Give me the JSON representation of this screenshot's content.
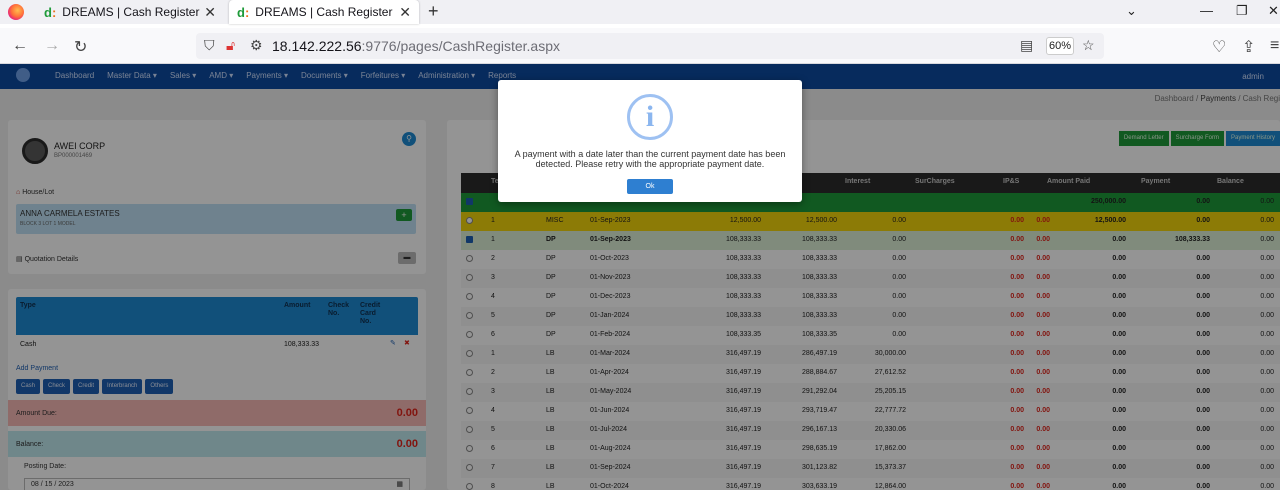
{
  "browser": {
    "tabs": [
      {
        "title": "DREAMS | Cash Register"
      },
      {
        "title": "DREAMS | Cash Register"
      }
    ],
    "url_host": "18.142.222.56",
    "url_rest": ":9776/pages/CashRegister.aspx",
    "zoom": "60%"
  },
  "app": {
    "menu": [
      "Dashboard",
      "Master Data ▾",
      "Sales ▾",
      "AMD ▾",
      "Payments ▾",
      "Documents ▾",
      "Forfeitures ▾",
      "Administration ▾",
      "Reports"
    ],
    "user": "admin",
    "breadcrumb": {
      "a": "Dashboard",
      "b": "Payments",
      "c": "Cash Regi"
    },
    "client": {
      "name": "AWEI CORP",
      "id": "BP000001469"
    },
    "house_lot_label": "House/Lot",
    "estate": {
      "title": "ANNA CARMELA ESTATES",
      "subtitle": "BLOCK 3 LOT 1 MODEL"
    },
    "quotation_label": "Quotation Details",
    "payment_table": {
      "headers": {
        "type": "Type",
        "amount": "Amount",
        "check": "Check No.",
        "credit": "Credit Card No."
      },
      "row": {
        "type": "Cash",
        "amount": "108,333.33"
      }
    },
    "add_payment_label": "Add Payment",
    "payment_buttons": [
      "Cash",
      "Check",
      "Credit",
      "Interbranch",
      "Others"
    ],
    "amount_due": {
      "label": "Amount Due:",
      "value": "0.00"
    },
    "balance": {
      "label": "Balance:",
      "value": "0.00"
    },
    "posting_date": {
      "label": "Posting Date:",
      "value": "08 / 15 / 2023"
    },
    "right_buttons": [
      "Demand Letter",
      "Surcharge Form",
      "Payment History"
    ],
    "schedule": {
      "headers": {
        "no": "Te",
        "interest": "Interest",
        "surcharges": "SurCharges",
        "ips": "IP&S",
        "amount_paid": "Amount Paid",
        "payment": "Payment",
        "balance": "Balance"
      },
      "total": {
        "amount_paid": "250,000.00",
        "payment": "0.00",
        "balance": "0.00"
      },
      "rows": [
        {
          "no": "1",
          "type": "MISC",
          "date": "01-Sep-2023",
          "amount": "12,500.00",
          "principal": "12,500.00",
          "interest": "0.00",
          "ipa": "0.00",
          "ips": "0.00",
          "paid": "12,500.00",
          "payment": "0.00",
          "balance": "0.00"
        },
        {
          "no": "1",
          "type": "DP",
          "date": "01-Sep-2023",
          "amount": "108,333.33",
          "principal": "108,333.33",
          "interest": "0.00",
          "ipa": "0.00",
          "ips": "0.00",
          "paid": "0.00",
          "payment": "108,333.33",
          "balance": "0.00"
        },
        {
          "no": "2",
          "type": "DP",
          "date": "01-Oct-2023",
          "amount": "108,333.33",
          "principal": "108,333.33",
          "interest": "0.00",
          "ipa": "0.00",
          "ips": "0.00",
          "paid": "0.00",
          "payment": "0.00",
          "balance": "0.00"
        },
        {
          "no": "3",
          "type": "DP",
          "date": "01-Nov-2023",
          "amount": "108,333.33",
          "principal": "108,333.33",
          "interest": "0.00",
          "ipa": "0.00",
          "ips": "0.00",
          "paid": "0.00",
          "payment": "0.00",
          "balance": "0.00"
        },
        {
          "no": "4",
          "type": "DP",
          "date": "01-Dec-2023",
          "amount": "108,333.33",
          "principal": "108,333.33",
          "interest": "0.00",
          "ipa": "0.00",
          "ips": "0.00",
          "paid": "0.00",
          "payment": "0.00",
          "balance": "0.00"
        },
        {
          "no": "5",
          "type": "DP",
          "date": "01-Jan-2024",
          "amount": "108,333.33",
          "principal": "108,333.33",
          "interest": "0.00",
          "ipa": "0.00",
          "ips": "0.00",
          "paid": "0.00",
          "payment": "0.00",
          "balance": "0.00"
        },
        {
          "no": "6",
          "type": "DP",
          "date": "01-Feb-2024",
          "amount": "108,333.35",
          "principal": "108,333.35",
          "interest": "0.00",
          "ipa": "0.00",
          "ips": "0.00",
          "paid": "0.00",
          "payment": "0.00",
          "balance": "0.00"
        },
        {
          "no": "1",
          "type": "LB",
          "date": "01-Mar-2024",
          "amount": "316,497.19",
          "principal": "286,497.19",
          "interest": "30,000.00",
          "ipa": "0.00",
          "ips": "0.00",
          "paid": "0.00",
          "payment": "0.00",
          "balance": "0.00"
        },
        {
          "no": "2",
          "type": "LB",
          "date": "01-Apr-2024",
          "amount": "316,497.19",
          "principal": "288,884.67",
          "interest": "27,612.52",
          "ipa": "0.00",
          "ips": "0.00",
          "paid": "0.00",
          "payment": "0.00",
          "balance": "0.00"
        },
        {
          "no": "3",
          "type": "LB",
          "date": "01-May-2024",
          "amount": "316,497.19",
          "principal": "291,292.04",
          "interest": "25,205.15",
          "ipa": "0.00",
          "ips": "0.00",
          "paid": "0.00",
          "payment": "0.00",
          "balance": "0.00"
        },
        {
          "no": "4",
          "type": "LB",
          "date": "01-Jun-2024",
          "amount": "316,497.19",
          "principal": "293,719.47",
          "interest": "22,777.72",
          "ipa": "0.00",
          "ips": "0.00",
          "paid": "0.00",
          "payment": "0.00",
          "balance": "0.00"
        },
        {
          "no": "5",
          "type": "LB",
          "date": "01-Jul-2024",
          "amount": "316,497.19",
          "principal": "296,167.13",
          "interest": "20,330.06",
          "ipa": "0.00",
          "ips": "0.00",
          "paid": "0.00",
          "payment": "0.00",
          "balance": "0.00"
        },
        {
          "no": "6",
          "type": "LB",
          "date": "01-Aug-2024",
          "amount": "316,497.19",
          "principal": "298,635.19",
          "interest": "17,862.00",
          "ipa": "0.00",
          "ips": "0.00",
          "paid": "0.00",
          "payment": "0.00",
          "balance": "0.00"
        },
        {
          "no": "7",
          "type": "LB",
          "date": "01-Sep-2024",
          "amount": "316,497.19",
          "principal": "301,123.82",
          "interest": "15,373.37",
          "ipa": "0.00",
          "ips": "0.00",
          "paid": "0.00",
          "payment": "0.00",
          "balance": "0.00"
        },
        {
          "no": "8",
          "type": "LB",
          "date": "01-Oct-2024",
          "amount": "316,497.19",
          "principal": "303,633.19",
          "interest": "12,864.00",
          "ipa": "0.00",
          "ips": "0.00",
          "paid": "0.00",
          "payment": "0.00",
          "balance": "0.00"
        }
      ]
    }
  },
  "modal": {
    "message": "A payment with a date later than the current payment date has been detected. Please retry with the appropriate payment date.",
    "ok_label": "Ok"
  }
}
